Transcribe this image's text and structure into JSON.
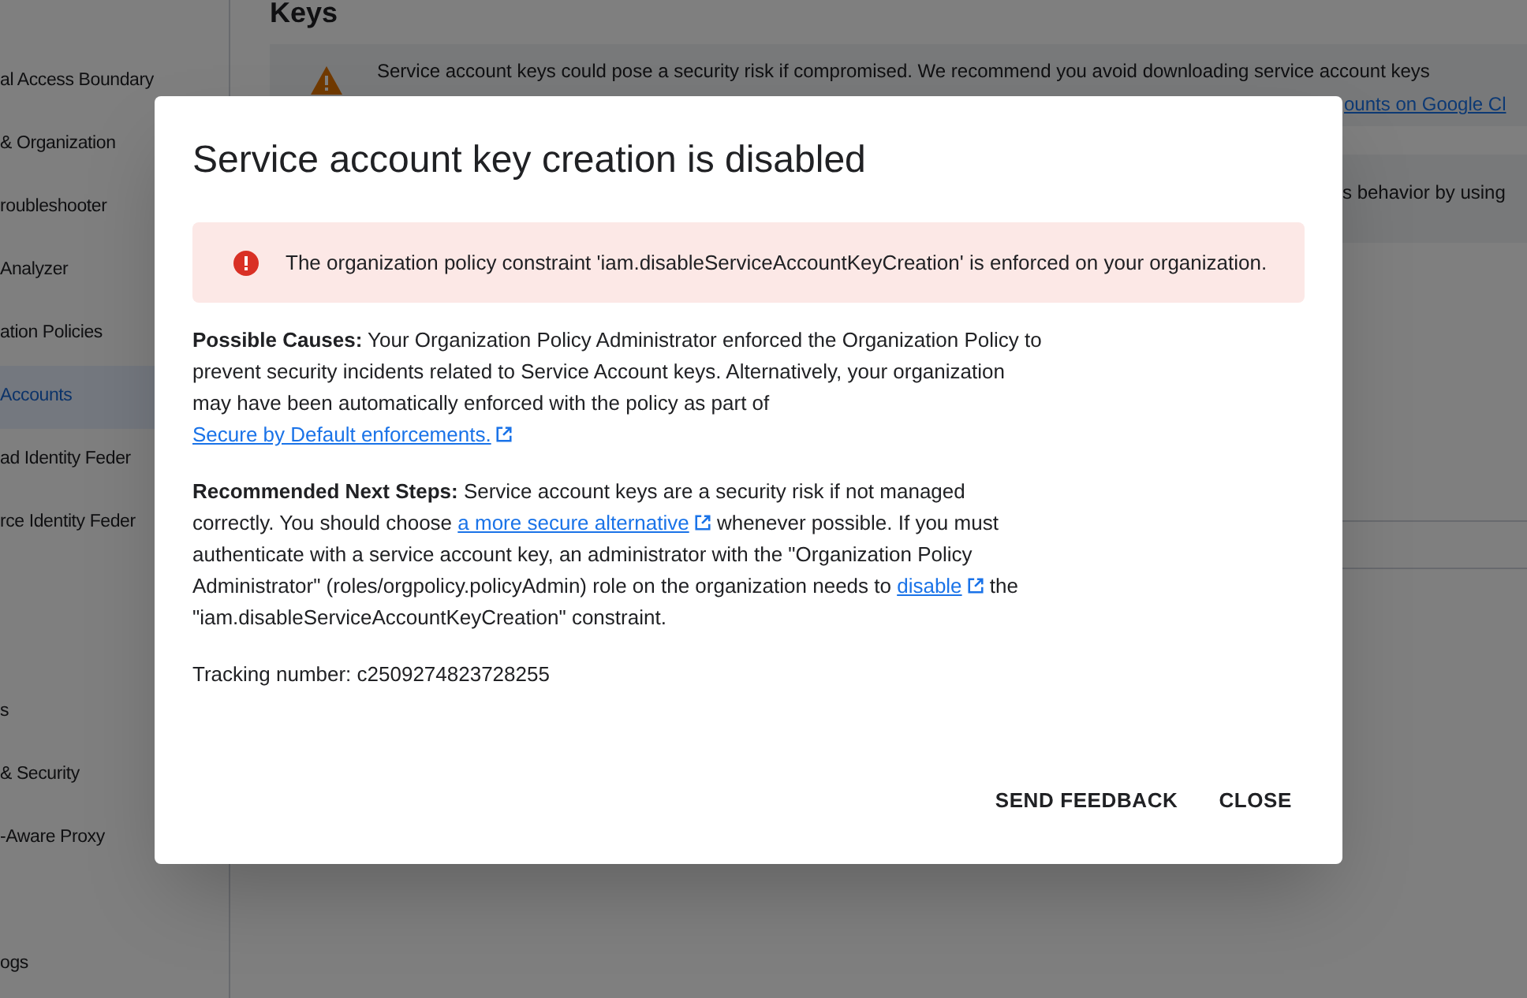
{
  "sidebar": {
    "sections": [
      {
        "items": [
          {
            "label": "al Access Boundary",
            "selected": false
          },
          {
            "label": "& Organization",
            "selected": false
          },
          {
            "label": "roubleshooter",
            "selected": false
          },
          {
            "label": "Analyzer",
            "selected": false
          },
          {
            "label": "ation Policies",
            "selected": false
          },
          {
            "label": "Accounts",
            "selected": true
          },
          {
            "label": "ad Identity Feder",
            "selected": false
          },
          {
            "label": "rce Identity Feder",
            "selected": false
          }
        ]
      },
      {
        "items": [
          {
            "label": "s",
            "selected": false
          },
          {
            "label": "& Security",
            "selected": false
          },
          {
            "label": "-Aware Proxy",
            "selected": false
          }
        ]
      },
      {
        "items": [
          {
            "label": "ogs",
            "selected": false
          }
        ]
      }
    ]
  },
  "main": {
    "heading": "Keys",
    "warning": {
      "text": "Service account keys could pose a security risk if compromised. We recommend you avoid downloading service account keys",
      "link": "ounts on Google Cl"
    },
    "notice": {
      "text": "s behavior by using"
    }
  },
  "dialog": {
    "title": "Service account key creation is disabled",
    "error": "The organization policy constraint 'iam.disableServiceAccountKeyCreation' is enforced on your organization.",
    "paragraphs": [
      {
        "label": "Possible Causes:",
        "parts": [
          {
            "kind": "text",
            "text": " Your Organization Policy Administrator enforced the Organization Policy to prevent security incidents related to Service Account keys. Alternatively, your organization may have been automatically enforced with the policy as part of "
          },
          {
            "kind": "link",
            "text": "Secure by Default enforcements."
          }
        ]
      },
      {
        "label": "Recommended Next Steps:",
        "parts": [
          {
            "kind": "text",
            "text": " Service account keys are a security risk if not managed correctly. You should choose "
          },
          {
            "kind": "link",
            "text": "a more secure alternative"
          },
          {
            "kind": "text",
            "text": " whenever possible. If you must authenticate with a service account key, an administrator with the \"Organization Policy Administrator\" (roles/orgpolicy.policyAdmin) role on the organization needs to "
          },
          {
            "kind": "link",
            "text": "disable"
          },
          {
            "kind": "text",
            "text": " the \"iam.disableServiceAccountKeyCreation\" constraint."
          }
        ]
      }
    ],
    "tracking": "Tracking number: c2509274823728255",
    "buttons": [
      "SEND FEEDBACK",
      "CLOSE"
    ]
  }
}
